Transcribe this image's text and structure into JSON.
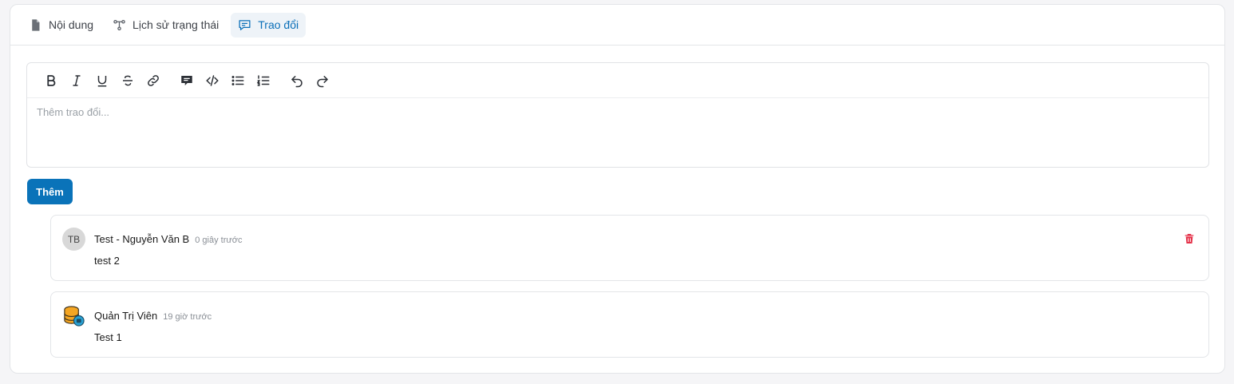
{
  "tabs": [
    {
      "label": "Nội dung",
      "icon": "document-icon",
      "active": false
    },
    {
      "label": "Lịch sử trạng thái",
      "icon": "flow-icon",
      "active": false
    },
    {
      "label": "Trao đổi",
      "icon": "chat-icon",
      "active": true
    }
  ],
  "editor": {
    "toolbar": [
      "bold-icon",
      "italic-icon",
      "underline-icon",
      "strikethrough-icon",
      "link-icon",
      "comment-icon",
      "code-icon",
      "bullet-list-icon",
      "numbered-list-icon",
      "undo-icon",
      "redo-icon"
    ],
    "placeholder": "Thêm trao đổi..."
  },
  "add_button_label": "Thêm",
  "comments": [
    {
      "avatar_initials": "TB",
      "author": "Test - Nguyễn Văn B",
      "time": "0 giây trước",
      "text": "test 2",
      "deletable": true
    },
    {
      "avatar_initials": "",
      "author": "Quản Trị Viên",
      "time": "19 giờ trước",
      "text": "Test 1",
      "deletable": false
    }
  ],
  "colors": {
    "accent": "#0a73b9",
    "active_tab_bg": "#eef3f8",
    "delete": "#e5344b",
    "border": "#e3e5e8"
  }
}
